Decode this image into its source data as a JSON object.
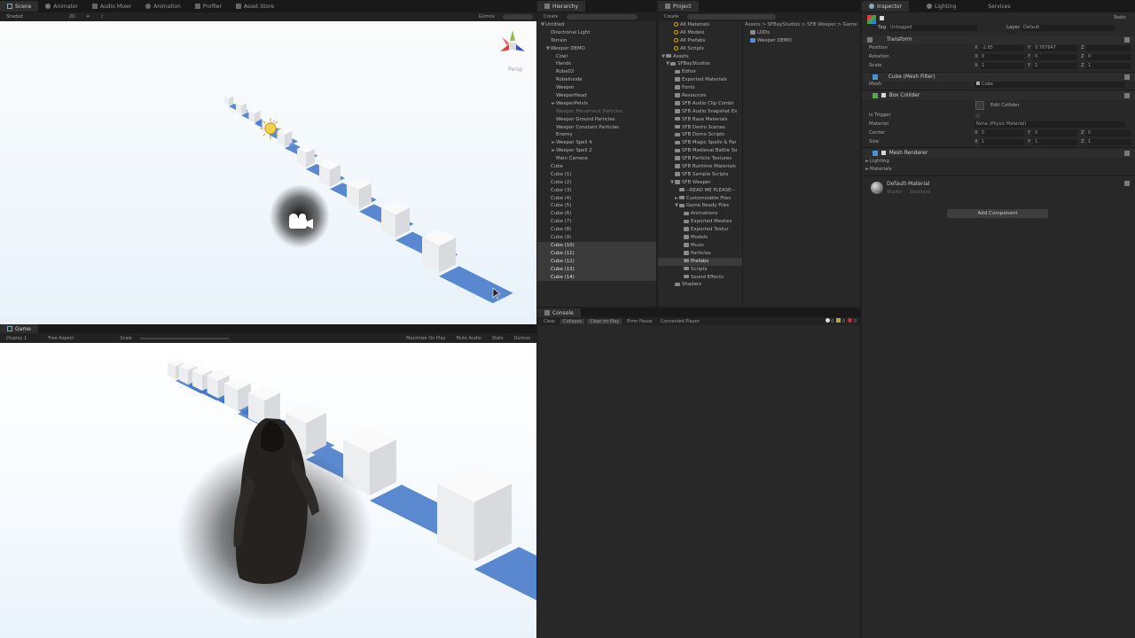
{
  "scene": {
    "tabs": [
      "Scene",
      "Animator",
      "Audio Mixer",
      "Animation",
      "Profiler",
      "Asset Store"
    ],
    "toolbar": {
      "shading": "Shaded",
      "mode2d": "2D",
      "gizmos": "Gizmos"
    },
    "persp": "Persp"
  },
  "game": {
    "tab": "Game",
    "display": "Display 1",
    "aspect": "Free Aspect",
    "scale": "Scale",
    "maximize": "Maximize On Play",
    "mute": "Mute Audio",
    "stats": "Stats",
    "gizmos": "Gizmos"
  },
  "hierarchy": {
    "tab": "Hierarchy",
    "create": "Create",
    "items": [
      {
        "label": "Untitled",
        "indent": 0,
        "fold": "▼"
      },
      {
        "label": "Directional Light",
        "indent": 1
      },
      {
        "label": "Terrain",
        "indent": 1
      },
      {
        "label": "Weeper DEMO",
        "indent": 1,
        "fold": "▼"
      },
      {
        "label": "Cowl",
        "indent": 2
      },
      {
        "label": "Hands",
        "indent": 2
      },
      {
        "label": "Robe02",
        "indent": 2
      },
      {
        "label": "RobeInside",
        "indent": 2
      },
      {
        "label": "Weeper",
        "indent": 2
      },
      {
        "label": "WeeperHead",
        "indent": 2
      },
      {
        "label": "WeeperPelvis",
        "indent": 2,
        "fold": "►"
      },
      {
        "label": "Weeper Movement Particles",
        "indent": 2,
        "dim": true
      },
      {
        "label": "Weeper Ground Particles",
        "indent": 2
      },
      {
        "label": "Weeper Constant Particles",
        "indent": 2
      },
      {
        "label": "Enemy",
        "indent": 2
      },
      {
        "label": "Weeper Spell 4",
        "indent": 2,
        "fold": "►"
      },
      {
        "label": "Weeper Spell 2",
        "indent": 2,
        "fold": "►"
      },
      {
        "label": "Main Camera",
        "indent": 2
      },
      {
        "label": "Cube",
        "indent": 1
      },
      {
        "label": "Cube (1)",
        "indent": 1
      },
      {
        "label": "Cube (2)",
        "indent": 1
      },
      {
        "label": "Cube (3)",
        "indent": 1
      },
      {
        "label": "Cube (4)",
        "indent": 1
      },
      {
        "label": "Cube (5)",
        "indent": 1
      },
      {
        "label": "Cube (6)",
        "indent": 1
      },
      {
        "label": "Cube (7)",
        "indent": 1
      },
      {
        "label": "Cube (8)",
        "indent": 1
      },
      {
        "label": "Cube (9)",
        "indent": 1
      },
      {
        "label": "Cube (10)",
        "indent": 1,
        "sel": true
      },
      {
        "label": "Cube (11)",
        "indent": 1,
        "sel": true
      },
      {
        "label": "Cube (12)",
        "indent": 1,
        "sel": true
      },
      {
        "label": "Cube (13)",
        "indent": 1,
        "sel": true
      },
      {
        "label": "Cube (14)",
        "indent": 1,
        "sel": true
      }
    ]
  },
  "project": {
    "tab": "Project",
    "create": "Create",
    "favorites": [
      "All Materials",
      "All Models",
      "All Prefabs",
      "All Scripts"
    ],
    "breadcrumb": "Assets > SFBayStudios > SFB Weeper > Game",
    "tree": [
      {
        "label": "Assets",
        "indent": 0,
        "fold": "▼"
      },
      {
        "label": "Assets",
        "indent": 0,
        "fold": "▼"
      },
      {
        "label": "SFBayStudios",
        "indent": 1,
        "fold": "▼"
      },
      {
        "label": "Editor",
        "indent": 2
      },
      {
        "label": "Exported Materials",
        "indent": 2
      },
      {
        "label": "Fonts",
        "indent": 2
      },
      {
        "label": "Resources",
        "indent": 2
      },
      {
        "label": "SFB Audio Clip Combi",
        "indent": 2
      },
      {
        "label": "SFB Audio Snapshot Ex",
        "indent": 2
      },
      {
        "label": "SFB Base Materials",
        "indent": 2
      },
      {
        "label": "SFB Demo Scenes",
        "indent": 2
      },
      {
        "label": "SFB Demo Scripts",
        "indent": 2
      },
      {
        "label": "SFB Magic Spells & Par",
        "indent": 2
      },
      {
        "label": "SFB Medieval Battle So",
        "indent": 2
      },
      {
        "label": "SFB Particle Textures",
        "indent": 2
      },
      {
        "label": "SFB Runtime Materials",
        "indent": 2
      },
      {
        "label": "SFB Sample Scripts",
        "indent": 2
      },
      {
        "label": "SFB Weeper",
        "indent": 2,
        "fold": "▼"
      },
      {
        "label": "--READ ME PLEASE--",
        "indent": 3
      },
      {
        "label": "Customizable Files",
        "indent": 3,
        "fold": "►"
      },
      {
        "label": "Game Ready Files",
        "indent": 3,
        "fold": "▼"
      },
      {
        "label": "Animations",
        "indent": 4
      },
      {
        "label": "Exported Meshes",
        "indent": 4
      },
      {
        "label": "Exported Textur",
        "indent": 4
      },
      {
        "label": "Models",
        "indent": 4
      },
      {
        "label": "Music",
        "indent": 4
      },
      {
        "label": "Particles",
        "indent": 4
      },
      {
        "label": "Prefabs",
        "indent": 4,
        "sel": true
      },
      {
        "label": "Scripts",
        "indent": 4
      },
      {
        "label": "Sound Effects",
        "indent": 4
      },
      {
        "label": "Shaders",
        "indent": 2
      }
    ],
    "files": [
      "LODs",
      "Weeper DEMO"
    ]
  },
  "console": {
    "tab": "Console",
    "buttons": [
      "Clear",
      "Collapse",
      "Clear on Play",
      "Error Pause",
      "Connected Player"
    ],
    "counts": [
      "0",
      "0",
      "0"
    ]
  },
  "inspector": {
    "tabs": [
      "Inspector",
      "Lighting",
      "Services"
    ],
    "static": "Static",
    "tag_label": "Tag",
    "tag_value": "Untagged",
    "layer_label": "Layer",
    "layer_value": "Default",
    "transform": {
      "title": "Transform",
      "position": {
        "label": "Position",
        "x": "-2.65",
        "y": "0.767647",
        "z": ""
      },
      "rotation": {
        "label": "Rotation",
        "x": "0",
        "y": "0",
        "z": "0"
      },
      "scale": {
        "label": "Scale",
        "x": "1",
        "y": "1",
        "z": "1"
      }
    },
    "mesh_filter": {
      "title": "Cube (Mesh Filter)",
      "mesh_label": "Mesh",
      "mesh_value": "Cube"
    },
    "box_collider": {
      "title": "Box Collider",
      "edit": "Edit Collider",
      "trigger_label": "Is Trigger",
      "material_label": "Material",
      "material_value": "None (Physic Material)",
      "center": {
        "label": "Center",
        "x": "0",
        "y": "0",
        "z": "0"
      },
      "size": {
        "label": "Size",
        "x": "1",
        "y": "1",
        "z": "1"
      }
    },
    "mesh_renderer": {
      "title": "Mesh Renderer",
      "lighting": "Lighting",
      "materials": "Materials"
    },
    "material": {
      "name": "Default-Material",
      "shader_label": "Shader",
      "shader_value": "Standard"
    },
    "add_component": "Add Component",
    "axis": {
      "x": "X",
      "y": "Y",
      "z": "Z"
    }
  },
  "colors": {
    "accent": "#3d7fc4",
    "panel": "#282828",
    "tabbar": "#191919",
    "cube_shadow": "#3f74c8",
    "folder": "#8a8a8a",
    "search": "#d9a800"
  }
}
